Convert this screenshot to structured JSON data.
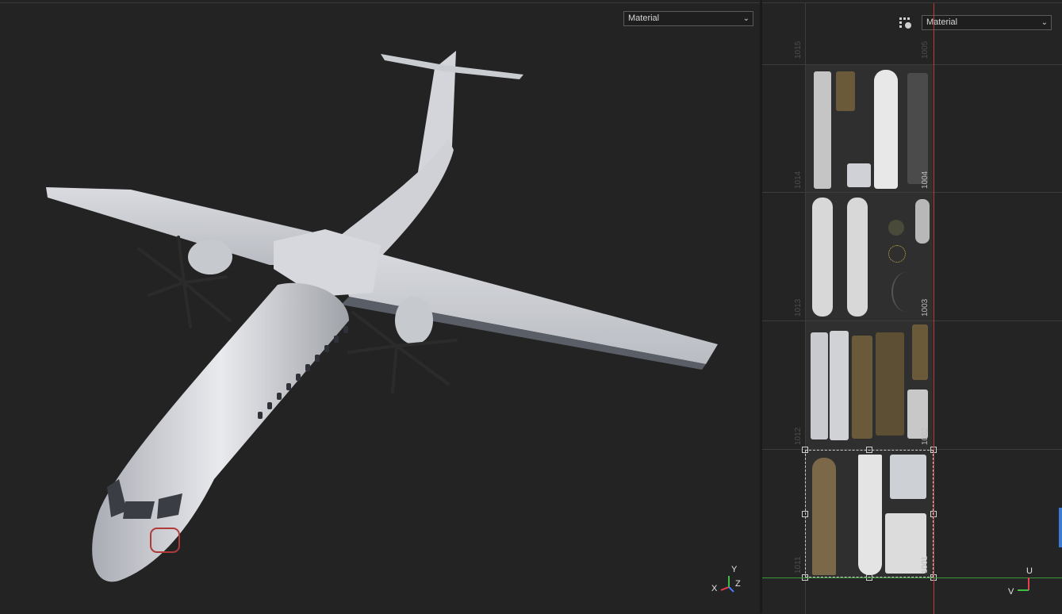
{
  "viewport3d": {
    "shading_mode": "Material",
    "axes": {
      "x": "X",
      "y": "Y",
      "z": "Z"
    }
  },
  "uv_editor": {
    "shading_mode": "Material",
    "axes": {
      "u": "U",
      "v": "V"
    },
    "udim_tiles": [
      {
        "left": "1014",
        "right": "1004"
      },
      {
        "left": "1013",
        "right": "1003"
      },
      {
        "left": "1012",
        "right": "1002"
      },
      {
        "left": "1011",
        "right": "1001"
      }
    ],
    "top_row": {
      "left": "1015",
      "right": "1005"
    }
  },
  "colors": {
    "background": "#232323",
    "axis_u": "#e8404a",
    "axis_v": "#3fbf3f",
    "guide_red": "#c23a3a",
    "guide_green": "#3a9a3a"
  }
}
